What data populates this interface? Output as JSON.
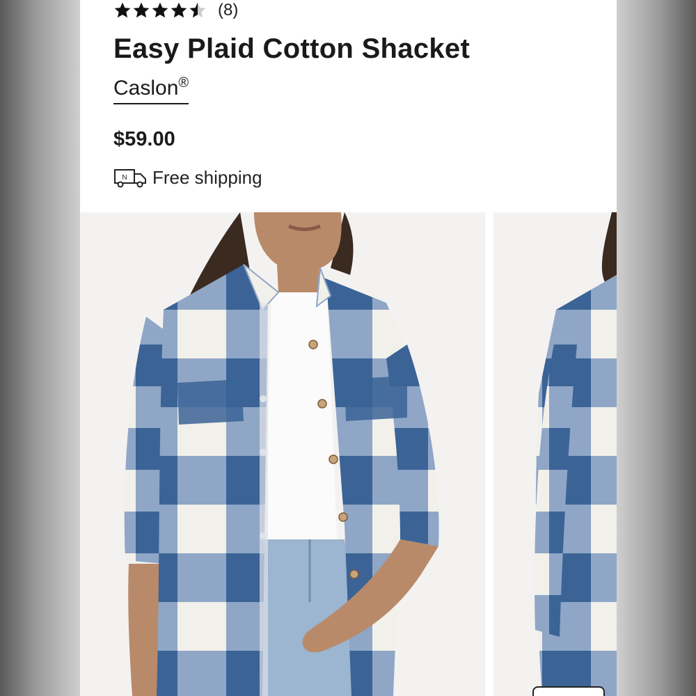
{
  "product": {
    "rating_value": 4.5,
    "rating_max": 5,
    "review_count": "(8)",
    "title": "Easy Plaid Cotton Shacket",
    "brand": "Caslon",
    "brand_mark": "®",
    "price": "$59.00",
    "shipping_label": "Free shipping",
    "truck_letter": "N"
  },
  "icons": [
    "star-icon",
    "delivery-truck-icon"
  ],
  "colors": {
    "text": "#1a1a1a",
    "plaid_blue": "#3b6396",
    "plaid_light": "#8fa6c6",
    "plaid_white": "#f2f0ea",
    "background": "#ffffff"
  },
  "images": {
    "main": "model-wearing-blue-white-buffalo-plaid-shacket-front",
    "secondary": "shacket-side-view"
  }
}
